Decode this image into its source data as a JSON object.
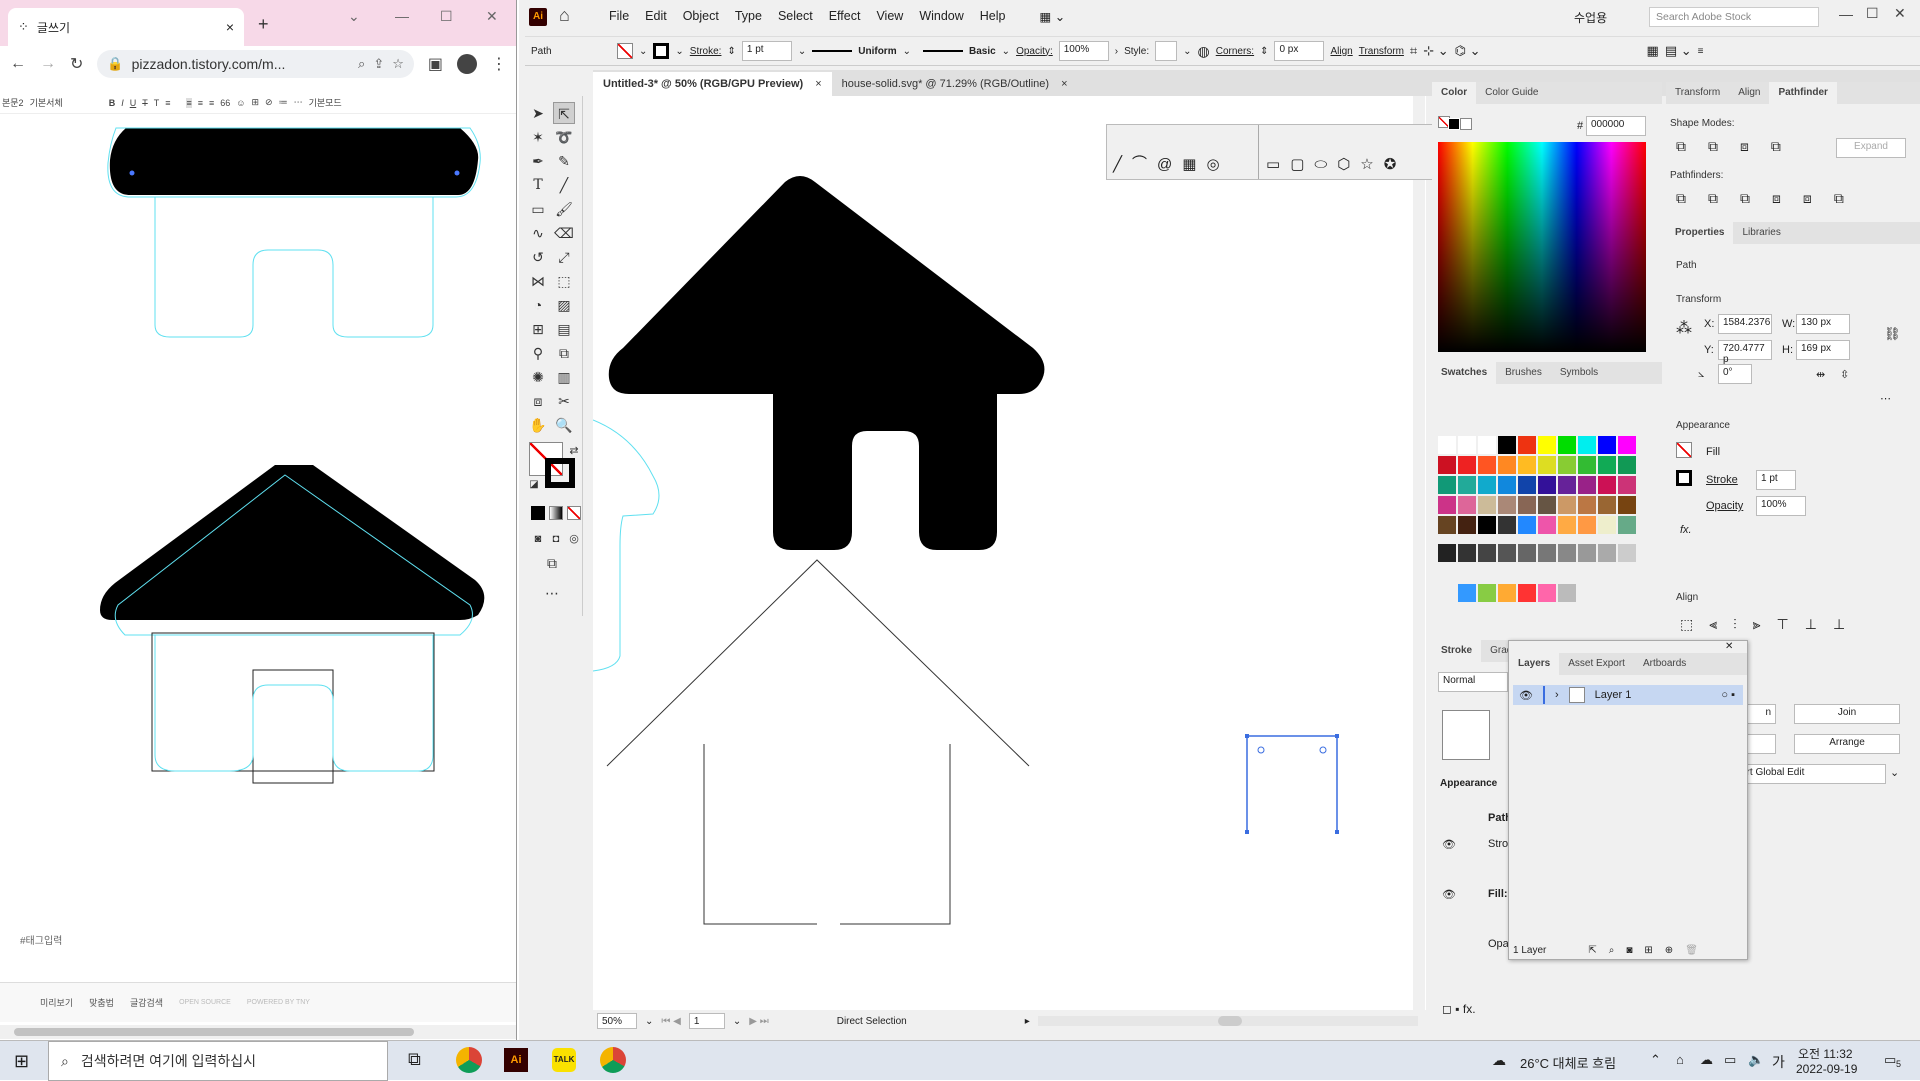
{
  "browser": {
    "tab_title": "글쓰기",
    "url": "pizzadon.tistory.com/m...",
    "new_tab": "+"
  },
  "editor": {
    "toolbar": [
      "본문2",
      "기본서체",
      "B",
      "I",
      "U",
      "T",
      "T",
      "≡",
      "≡",
      "≡",
      "≡",
      "66",
      "☺",
      "⊞",
      "⊘",
      "≔",
      "⋯",
      "기본모드"
    ],
    "tag_placeholder": "#태그입력",
    "footer": [
      "미리보기",
      "맞춤법",
      "글감검색",
      "OPEN SOURCE",
      "POWERED BY TNY"
    ]
  },
  "ai": {
    "menus": [
      "File",
      "Edit",
      "Object",
      "Type",
      "Select",
      "Effect",
      "View",
      "Window",
      "Help"
    ],
    "user": "수업용",
    "search_placeholder": "Search Adobe Stock",
    "control": {
      "selection": "Path",
      "stroke_label": "Stroke:",
      "stroke_weight": "1 pt",
      "profile": "Uniform",
      "brush": "Basic",
      "opacity_label": "Opacity:",
      "opacity": "100%",
      "style_label": "Style:",
      "corners_label": "Corners:",
      "corners": "0 px",
      "align": "Align",
      "transform": "Transform"
    },
    "doc_tabs": [
      {
        "label": "Untitled-3* @ 50% (RGB/GPU Preview)",
        "close": "×"
      },
      {
        "label": "house-solid.svg* @ 71.29% (RGB/Outline)",
        "close": "×"
      }
    ],
    "status": {
      "zoom": "50%",
      "artboard": "1",
      "tool": "Direct Selection"
    },
    "color_panel": {
      "tabs": [
        "Color",
        "Color Guide"
      ],
      "hex_label": "#",
      "hex": "000000"
    },
    "swatches_panel": {
      "tabs": [
        "Swatches",
        "Brushes",
        "Symbols"
      ]
    },
    "stroke_panel": {
      "tabs": [
        "Stroke",
        "Grad"
      ],
      "blend": "Normal",
      "appearance_title": "Appearance",
      "path": "Path",
      "stroke": "Strok",
      "fill": "Fill:",
      "opacity": "Opac"
    },
    "right_tabs1": [
      "Transform",
      "Align",
      "Pathfinder"
    ],
    "pathfinder": {
      "shape_modes": "Shape Modes:",
      "pathfinders": "Pathfinders:",
      "expand": "Expand"
    },
    "right_tabs2": [
      "Properties",
      "Libraries"
    ],
    "properties": {
      "kind": "Path",
      "transform_title": "Transform",
      "x_label": "X:",
      "x": "1584.2376",
      "y_label": "Y:",
      "y": "720.4777 p",
      "w_label": "W:",
      "w": "130 px",
      "h_label": "H:",
      "h": "169 px",
      "angle": "0°",
      "appearance_title": "Appearance",
      "fill": "Fill",
      "stroke": "Stroke",
      "stroke_weight": "1 pt",
      "opacity": "Opacity",
      "opacity_value": "100%",
      "fx": "fx.",
      "align_title": "Align",
      "join": "Join",
      "arrange": "Arrange",
      "global_edit": "art Global Edit",
      "partial_button": "n"
    },
    "layers": {
      "tabs": [
        "Layers",
        "Asset Export",
        "Artboards"
      ],
      "layer_name": "Layer 1",
      "count": "1 Layer"
    }
  },
  "taskbar": {
    "search_placeholder": "검색하려면 여기에 입력하십시",
    "weather": "26°C  대체로 흐림",
    "time": "오전 11:32",
    "date": "2022-09-19",
    "ime": "가",
    "notif": "5"
  },
  "colors": {
    "accent": "#4a90d9",
    "cyan_outline": "#5fe0f0",
    "ai_bg": "#f0f0f0"
  }
}
